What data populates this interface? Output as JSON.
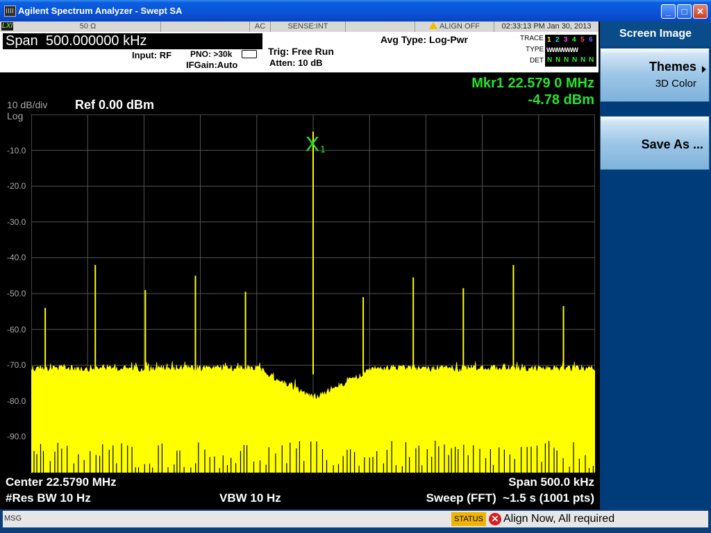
{
  "window": {
    "title": "Agilent Spectrum Analyzer - Swept SA",
    "app_icon": "spectrum-analyzer-icon"
  },
  "window_controls": {
    "minimize": "_",
    "maximize": "□",
    "close": "✕"
  },
  "status_bar": {
    "lxi": "LXI",
    "impedance": "50 Ω",
    "coupling": "AC",
    "sense": "SENSE:INT",
    "align": "ALIGN OFF",
    "datetime": "02:33:13 PM Jan 30, 2013"
  },
  "settings": {
    "span_label": "Span",
    "span_value": "500.000000 kHz",
    "input": "Input: RF",
    "pno": "PNO: >30k",
    "ifgain": "IFGain:Auto",
    "trig": "Trig: Free Run",
    "atten": "Atten: 10 dB",
    "avg_type": "Avg Type: Log-Pwr",
    "trace_label": "TRACE",
    "type_label": "TYPE",
    "det_label": "DET",
    "trace_numbers": [
      "1",
      "2",
      "3",
      "4",
      "5",
      "6"
    ],
    "trace_colors": [
      "#ffff00",
      "#00e6e6",
      "#ff40ff",
      "#40ff40",
      "#ff5050",
      "#6464ff"
    ],
    "trace_types": "WWWWWW",
    "trace_dets": [
      "N",
      "N",
      "N",
      "N",
      "N",
      "N"
    ]
  },
  "display": {
    "scale": "10 dB/div",
    "scale_type": "Log",
    "ref_level": "Ref 0.00 dBm",
    "marker_freq": "Mkr1 22.579 0 MHz",
    "marker_amp": "-4.78 dBm",
    "marker_symbol": "X",
    "marker_number": "1",
    "y_ticks": [
      "-10.0",
      "-20.0",
      "-30.0",
      "-40.0",
      "-50.0",
      "-60.0",
      "-70.0",
      "-80.0",
      "-90.0"
    ],
    "center": "Center 22.5790 MHz",
    "res_bw": "#Res BW 10 Hz",
    "vbw": "VBW 10 Hz",
    "span_bottom": "Span 500.0 kHz",
    "sweep": "Sweep (FFT)  ~1.5 s (1001 pts)",
    "trace_color": "#ffff00",
    "marker_color": "#29e22b"
  },
  "chart_data": {
    "type": "line",
    "xlim": [
      22.329,
      22.829
    ],
    "ylim": [
      -100,
      0
    ],
    "grid": true,
    "noise_floor_dbm": -71,
    "peaks": [
      {
        "x": 22.3414,
        "y": -54
      },
      {
        "x": 22.3858,
        "y": -42
      },
      {
        "x": 22.4302,
        "y": -49
      },
      {
        "x": 22.4746,
        "y": -45
      },
      {
        "x": 22.519,
        "y": -49.5
      },
      {
        "x": 22.579,
        "y": -4.78
      },
      {
        "x": 22.6234,
        "y": -51
      },
      {
        "x": 22.6678,
        "y": -45.5
      },
      {
        "x": 22.7122,
        "y": -48.5
      },
      {
        "x": 22.7566,
        "y": -42
      },
      {
        "x": 22.801,
        "y": -53.5
      }
    ]
  },
  "softkeys": {
    "header": "Screen Image",
    "themes_label": "Themes",
    "themes_value": "3D Color",
    "save_label": "Save As ..."
  },
  "message_bar": {
    "label": "MSG",
    "status_button": "STATUS",
    "message": "Align Now, All required"
  }
}
